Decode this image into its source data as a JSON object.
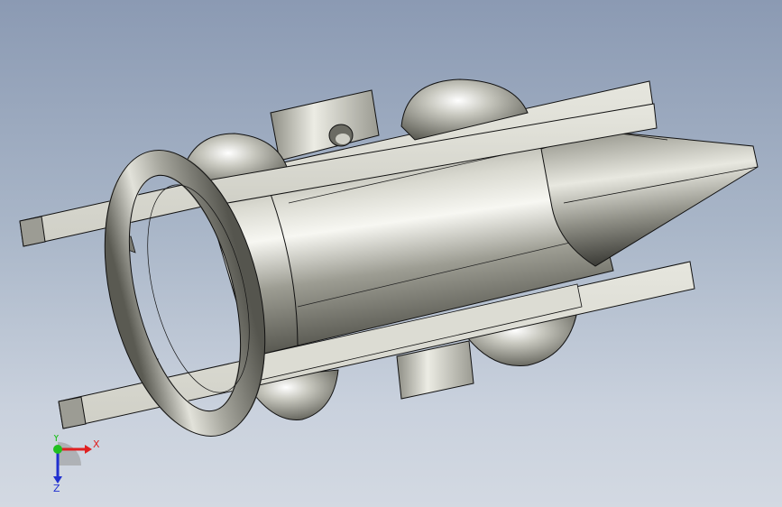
{
  "viewport": {
    "background_top": "#8b9ab3",
    "background_bottom": "#d3d9e2"
  },
  "model": {
    "parts": [
      "ring-part",
      "cylinder-body",
      "cone-nose",
      "upper-plate",
      "lower-plate",
      "upper-collar",
      "lower-collar",
      "dome-caps",
      "fins"
    ],
    "metal_color": "#c9c9bf",
    "edge_color": "#111111"
  },
  "triad": {
    "x_label": "X",
    "y_label": "Y",
    "z_label": "Z",
    "x_color": "#e02020",
    "y_color": "#20c020",
    "z_color": "#2030d0"
  }
}
